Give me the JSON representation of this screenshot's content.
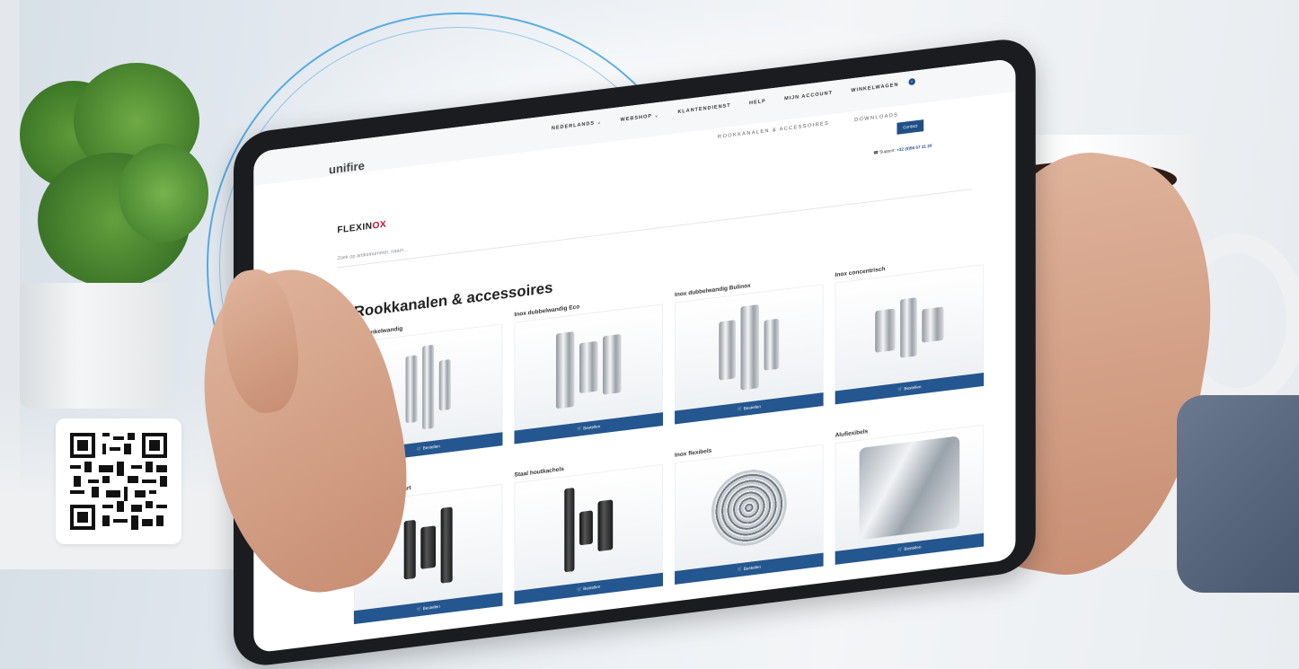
{
  "brand": {
    "unifire": "unifire",
    "logo_main": "FLEXIN",
    "logo_accent": "OX"
  },
  "nav": {
    "items": [
      "NEDERLANDS ⌄",
      "WEBSHOP ⌄",
      "KLANTENDIENST",
      "HELP",
      "MIJN ACCOUNT",
      "WINKELWAGEN"
    ],
    "subnav": [
      "ROOKKANALEN & ACCESSOIRES",
      "DOWNLOADS"
    ],
    "contact_button": "Contact",
    "support_label": "Support:",
    "support_phone": "+32 (0)56 67 21 20"
  },
  "search": {
    "placeholder": "Zoek op artikelnummer, naam..."
  },
  "page": {
    "title": "Rookkanalen & accessoires"
  },
  "order_button_label": "🛒 Bestellen",
  "categories": [
    {
      "title": "Inox enkelwandig"
    },
    {
      "title": "Inox dubbelwandig Eco"
    },
    {
      "title": "Inox dubbelwandig Bulinox"
    },
    {
      "title": "Inox concentrisch"
    },
    {
      "title": "Pelletkachels - zwart"
    },
    {
      "title": "Staal houtkachels"
    },
    {
      "title": "Inox flexibels"
    },
    {
      "title": "Alufiexibels"
    }
  ],
  "colors": {
    "accent_blue": "#24568f",
    "logo_red": "#c8102e",
    "arc_blue": "#3aa0dc"
  }
}
